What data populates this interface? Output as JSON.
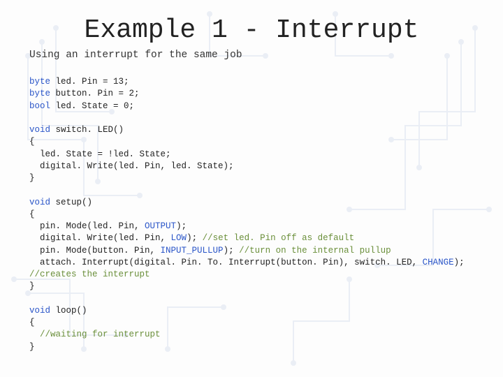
{
  "title": "Example 1 - Interrupt",
  "subtitle": "Using an interrupt for the same job",
  "code": {
    "decl": {
      "t_byte": "byte",
      "t_bool": "bool",
      "ledPin": " led. Pin = 13;",
      "buttonPin": " button. Pin = 2;",
      "ledState": " led. State = 0;"
    },
    "fn1": {
      "t_void": "void",
      "sig": " switch. LED()",
      "open": "{",
      "l1": "  led. State = !led. State;",
      "l2": "  digital. Write(led. Pin, led. State);",
      "close": "}"
    },
    "fn2": {
      "t_void": "void",
      "sig": " setup()",
      "open": "{",
      "l1a": "  pin. Mode(led. Pin, ",
      "l1b": "OUTPUT",
      "l1c": ");",
      "l2a": "  digital. Write(led. Pin, ",
      "l2b": "LOW",
      "l2c": "); ",
      "l2d": "//set led. Pin off as default",
      "l3a": "  pin. Mode(button. Pin, ",
      "l3b": "INPUT_PULLUP",
      "l3c": "); ",
      "l3d": "//turn on the internal pullup",
      "l4a": "  attach. Interrupt(digital. Pin. To. Interrupt(button. Pin), switch. LED, ",
      "l4b": "CHANGE",
      "l4c": "); ",
      "l4d": "//creates the interrupt",
      "close": "}"
    },
    "fn3": {
      "t_void": "void",
      "sig": " loop()",
      "open": "{",
      "l1": "  //waiting for interrupt",
      "close": "}"
    }
  }
}
